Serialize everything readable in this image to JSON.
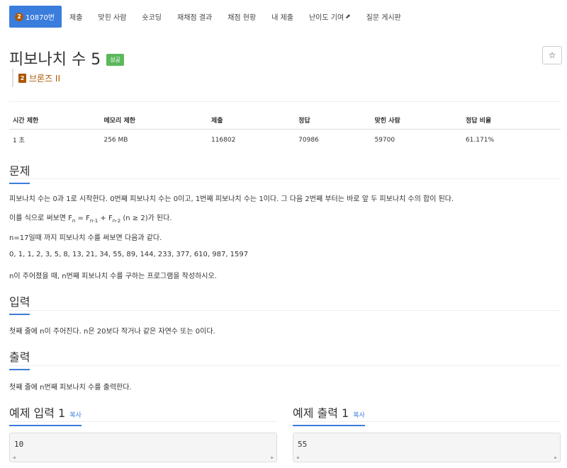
{
  "nav": {
    "problem_number": "10870번",
    "tier_number": "2",
    "items": [
      "제출",
      "맞힌 사람",
      "숏코딩",
      "재채점 결과",
      "채점 현황",
      "내 제출",
      "난이도 기여",
      "질문 게시판"
    ],
    "external_icon": "external-link-icon"
  },
  "problem": {
    "title": "피보나치 수 5",
    "status_badge": "성공",
    "star_icon": "☆",
    "tier_badge": "2",
    "tier_label": "브론즈 II",
    "tier_color": "#ad5600"
  },
  "info_table": {
    "headers": [
      "시간 제한",
      "메모리 제한",
      "제출",
      "정답",
      "맞힌 사람",
      "정답 비율"
    ],
    "values": [
      "1 초",
      "256 MB",
      "116802",
      "70986",
      "59700",
      "61.171%"
    ]
  },
  "sections": {
    "problem": {
      "title": "문제",
      "p1": "피보나치 수는 0과 1로 시작한다. 0번째 피보나치 수는 0이고, 1번째 피보나치 수는 1이다. 그 다음 2번째 부터는 바로 앞 두 피보나치 수의 합이 된다.",
      "p2_prefix": "이를 식으로 써보면 F",
      "p2_sub_n": "n",
      "p2_eq": " = F",
      "p2_sub_n1": "n-1",
      "p2_plus": " + F",
      "p2_sub_n2": "n-2",
      "p2_suffix": " (n ≥ 2)가 된다.",
      "p3": "n=17일때 까지 피보나치 수를 써보면 다음과 같다.",
      "p4": "0, 1, 1, 2, 3, 5, 8, 13, 21, 34, 55, 89, 144, 233, 377, 610, 987, 1597",
      "p5": "n이 주어졌을 때, n번째 피보나치 수를 구하는 프로그램을 작성하시오."
    },
    "input": {
      "title": "입력",
      "text": "첫째 줄에 n이 주어진다. n은 20보다 작거나 같은 자연수 또는 0이다."
    },
    "output": {
      "title": "출력",
      "text": "첫째 줄에 n번째 피보나치 수를 출력한다."
    }
  },
  "examples": {
    "input_title": "예제 입력 1",
    "input_copy": "복사",
    "input_value": "10",
    "output_title": "예제 출력 1",
    "output_copy": "복사",
    "output_value": "55"
  },
  "colors": {
    "primary": "#3b7ddd",
    "success": "#5cb85c",
    "bronze": "#ad5600"
  }
}
